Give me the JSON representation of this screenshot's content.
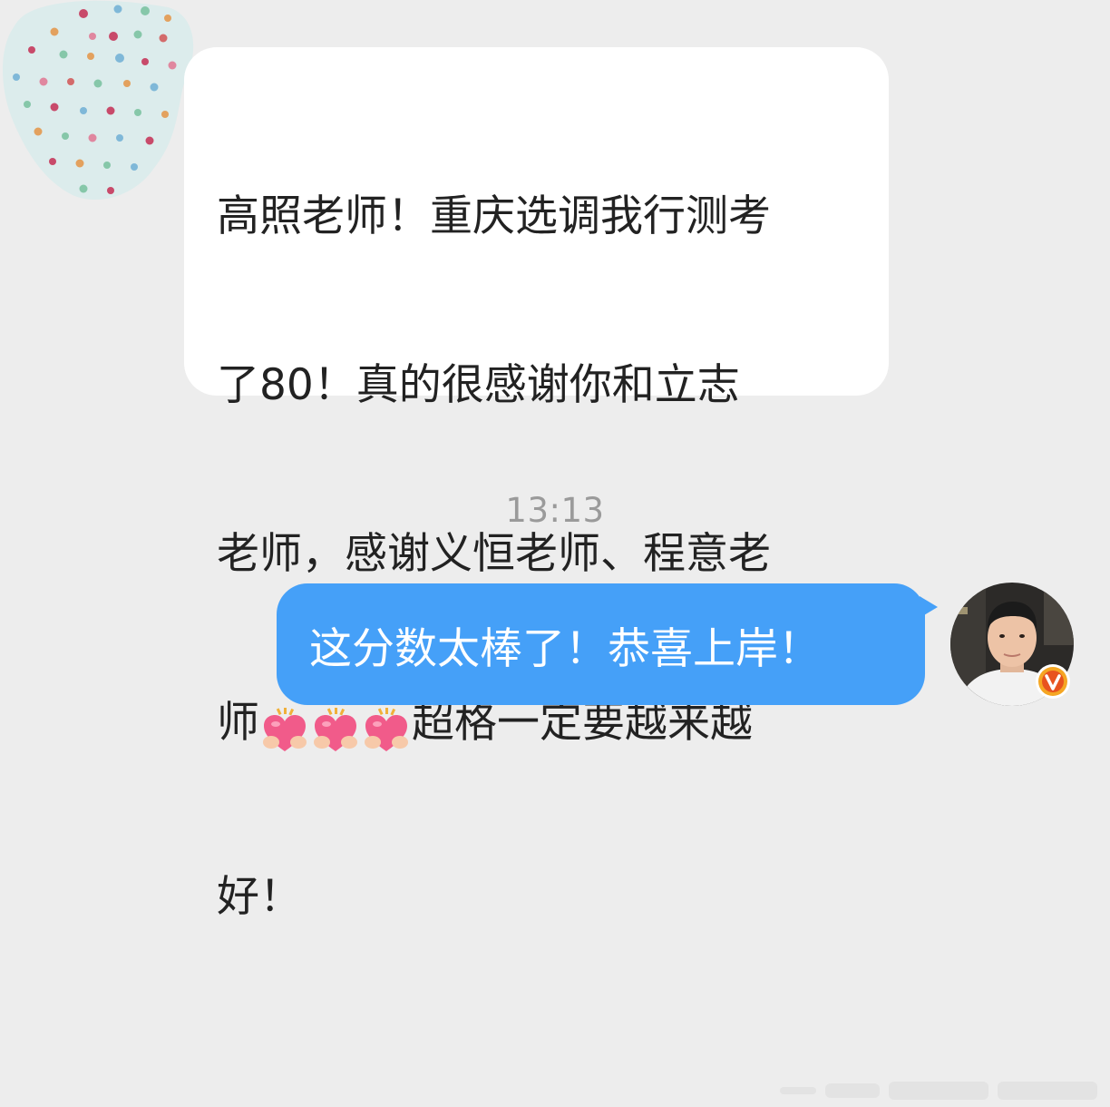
{
  "incoming_message": {
    "line1": "高照老师！重庆选调我行测考",
    "line2": "了80！真的很感谢你和立志",
    "line3": "老师，感谢义恒老师、程意老",
    "line4_start": "师",
    "line4_end": "超格一定要越来越",
    "line5": "好！",
    "emoji_icon": "heart-hug-emoji"
  },
  "timestamp": "13:13",
  "outgoing_message": {
    "text": "这分数太棒了！恭喜上岸！"
  },
  "colors": {
    "background": "#ededed",
    "incoming_bubble": "#ffffff",
    "outgoing_bubble": "#45a0f8",
    "verified_badge": "#f5a623"
  }
}
